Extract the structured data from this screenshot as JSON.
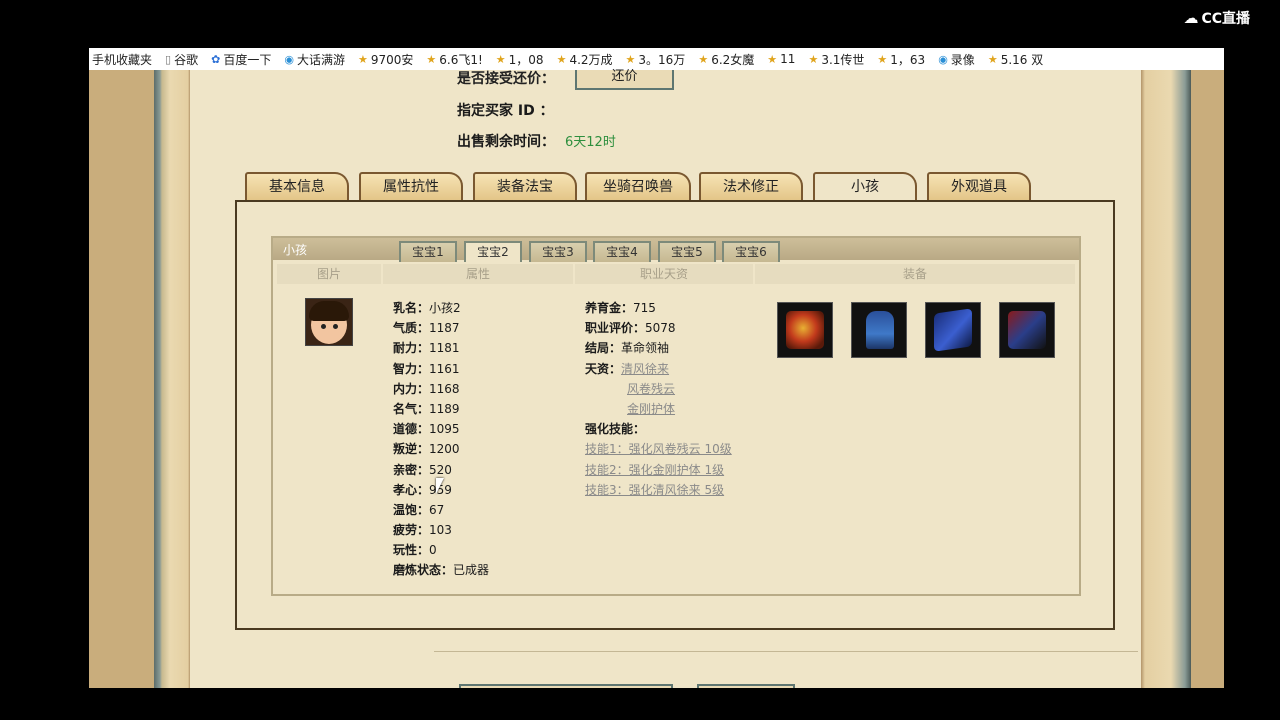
{
  "brand": {
    "name": "CC直播"
  },
  "bookmarks": [
    {
      "label": "手机收藏夹",
      "icon": "none"
    },
    {
      "label": "谷歌",
      "icon": "page-icon"
    },
    {
      "label": "百度一下",
      "icon": "paw-icon"
    },
    {
      "label": "大话满游",
      "icon": "ie-icon"
    },
    {
      "label": "9700安",
      "icon": "star-icon"
    },
    {
      "label": "6.6飞1!",
      "icon": "star-icon"
    },
    {
      "label": "1，08",
      "icon": "star-icon"
    },
    {
      "label": "4.2万成",
      "icon": "star-icon"
    },
    {
      "label": "3。16万",
      "icon": "star-icon"
    },
    {
      "label": "6.2女魔",
      "icon": "star-icon"
    },
    {
      "label": "11",
      "icon": "star-icon"
    },
    {
      "label": "3.1传世",
      "icon": "star-icon"
    },
    {
      "label": "1，63",
      "icon": "star-icon"
    },
    {
      "label": "录像",
      "icon": "ie-icon"
    },
    {
      "label": "5.16 双",
      "icon": "star-icon"
    }
  ],
  "trade": {
    "accept_label": "是否接受还价：",
    "bargain_button": "还价",
    "buyer_label": "指定买家 ID  ：",
    "time_label": "出售剩余时间：",
    "time_value": "6天12时"
  },
  "tabs": [
    "基本信息",
    "属性抗性",
    "装备法宝",
    "坐骑召唤兽",
    "法术修正",
    "小孩",
    "外观道具"
  ],
  "active_tab": "小孩",
  "child_panel": {
    "title": "小孩",
    "subtabs": [
      "宝宝1",
      "宝宝2",
      "宝宝3",
      "宝宝4",
      "宝宝5",
      "宝宝6"
    ],
    "columns": [
      "图片",
      "属性",
      "职业天资",
      "装备"
    ],
    "attributes": [
      {
        "k": "乳名：",
        "v": "小孩2"
      },
      {
        "k": "气质：",
        "v": "1187"
      },
      {
        "k": "耐力：",
        "v": "1181"
      },
      {
        "k": "智力：",
        "v": "1161"
      },
      {
        "k": "内力：",
        "v": "1168"
      },
      {
        "k": "名气：",
        "v": "1189"
      },
      {
        "k": "道德：",
        "v": "1095"
      },
      {
        "k": "叛逆：",
        "v": "1200"
      },
      {
        "k": "亲密：",
        "v": "520"
      },
      {
        "k": "孝心：",
        "v": "959"
      },
      {
        "k": "温饱：",
        "v": "67"
      },
      {
        "k": "疲劳：",
        "v": "103"
      },
      {
        "k": "玩性：",
        "v": "0"
      },
      {
        "k": "磨炼状态：",
        "v": "已成器"
      }
    ],
    "career": {
      "fund_label": "养育金：",
      "fund_value": "715",
      "rating_label": "职业评价：",
      "rating_value": "5078",
      "ending_label": "结局：",
      "ending_value": "革命领袖",
      "talent_label": "天资：",
      "talents": [
        "清风徐来",
        "风卷残云",
        "金刚护体"
      ],
      "skills_label": "强化技能：",
      "skills": [
        "技能1：强化风卷残云  10级",
        "技能2：强化金刚护体  1级",
        "技能3：强化清风徐来  5级"
      ]
    },
    "equipment_icons": [
      "treasure-chest-icon",
      "blue-robe-icon",
      "blue-book-icon",
      "armor-box-icon"
    ]
  },
  "colors": {
    "accent_green": "#2e8f3e",
    "frame_border": "#4a3a20"
  }
}
